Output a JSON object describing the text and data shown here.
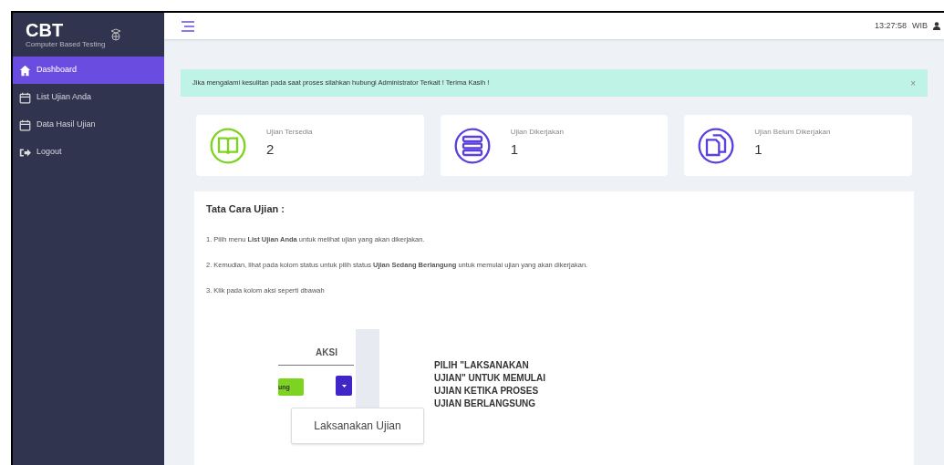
{
  "brand": {
    "logo": "CBT",
    "tagline": "Computer Based Testing"
  },
  "sidebar": {
    "items": [
      {
        "label": "Dashboard",
        "kind": "home",
        "selected": true
      },
      {
        "label": "List Ujian Anda",
        "kind": "calendar",
        "selected": false
      },
      {
        "label": "Data Hasil Ujian",
        "kind": "calendar",
        "selected": false
      },
      {
        "label": "Logout",
        "kind": "logout",
        "selected": false
      }
    ]
  },
  "header": {
    "time": "13:27:58",
    "zone": "WIB"
  },
  "alert": {
    "text": "Jika mengalami kesulitan pada saat proses silahkan hubungi Administrator Terkait ! Terima Kasih !",
    "close": "×"
  },
  "stats": [
    {
      "label": "Ujian Tersedia",
      "value": "2",
      "kind": "book",
      "color": "#7ed321"
    },
    {
      "label": "Ujian Dikerjakan",
      "value": "1",
      "kind": "list",
      "color": "#5b3fe0"
    },
    {
      "label": "Ujian Belum Dikerjakan",
      "value": "1",
      "kind": "copy",
      "color": "#5b3fe0"
    }
  ],
  "guide": {
    "title": "Tata Cara Ujian :",
    "steps": [
      "1. Pilih menu **List Ujian Anda** untuk melihat ujian yang akan dikerjakan.",
      "2. Kemudian, lihat pada kolom status untuk pilih status **Ujian Sedang Berlangung** untuk memulai ujian yang akan dikerjakan.",
      "3. Klik pada kolom aksi seperti dbawah"
    ],
    "example": {
      "column": "AKSI",
      "status": "ung",
      "menu_item": "Laksanakan Ujian",
      "caption": "PILIH \"LAKSANAKAN UJIAN\" UNTUK MEMULAI UJIAN KETIKA PROSES UJIAN BERLANGSUNG"
    }
  }
}
